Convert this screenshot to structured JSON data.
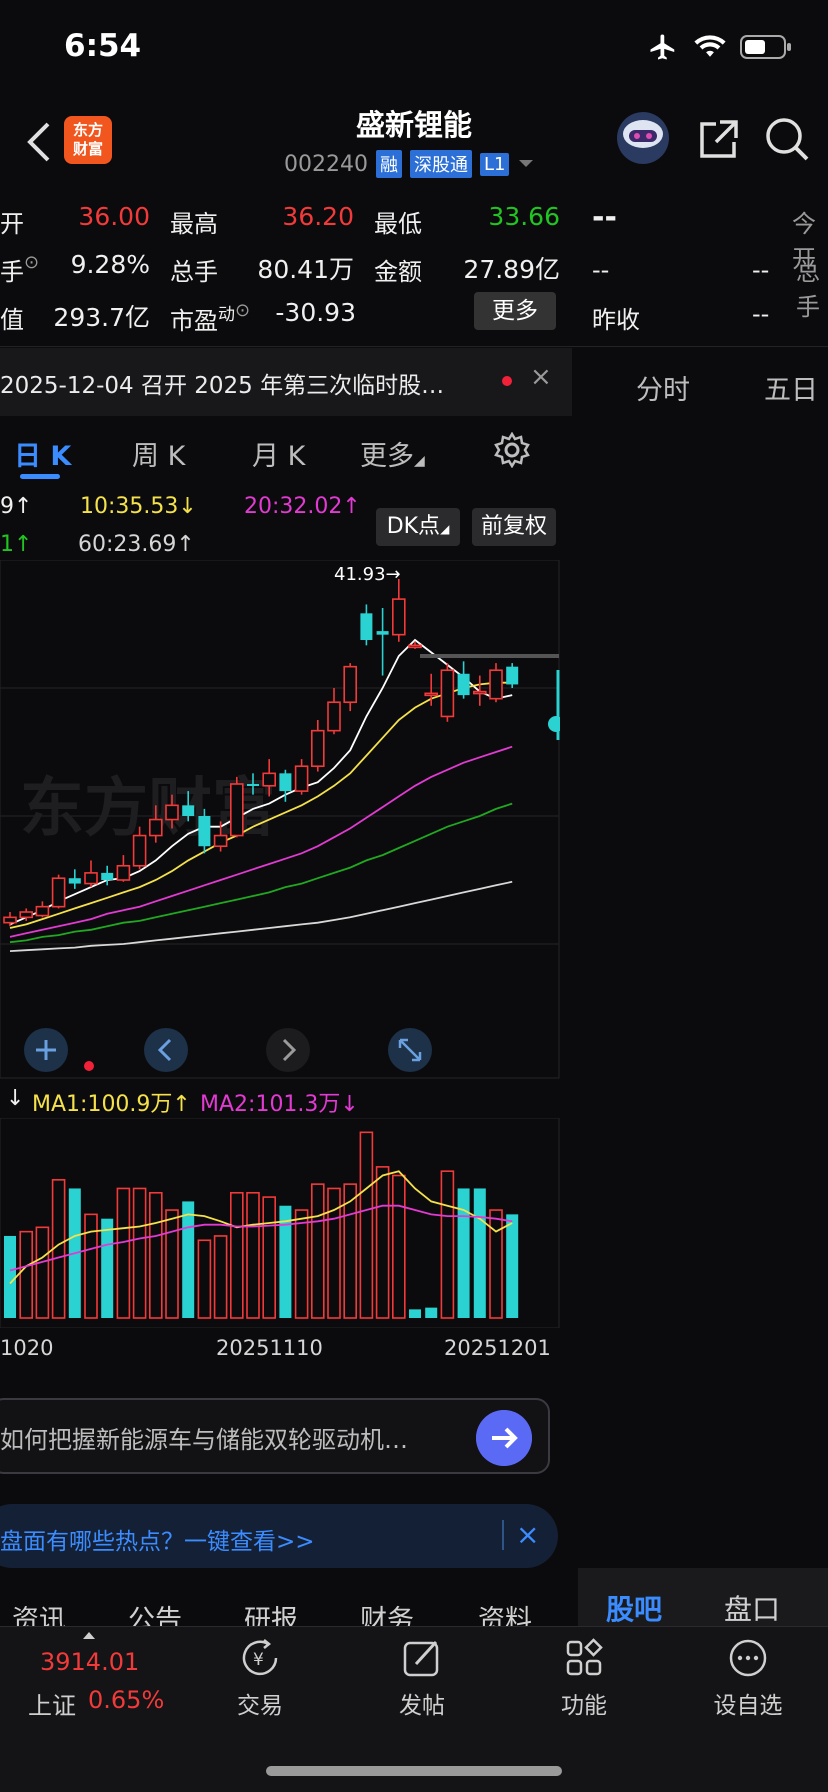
{
  "status": {
    "time": "6:54"
  },
  "header": {
    "logo_text_1": "东方",
    "logo_text_2": "财富",
    "stock_name": "盛新锂能",
    "stock_code": "002240",
    "tags": [
      "融",
      "深股通",
      "L1"
    ]
  },
  "quote": {
    "open_label": "开",
    "open_value": "36.00",
    "high_label": "最高",
    "high_value": "36.20",
    "low_label": "最低",
    "low_value": "33.66",
    "turnover_label": "手",
    "turnover_value": "9.28%",
    "volume_label": "总手",
    "volume_value": "80.41万",
    "amount_label": "金额",
    "amount_value": "27.89亿",
    "mktcap_label": "值",
    "mktcap_value": "293.7亿",
    "pe_label": "市盈",
    "pe_sup": "动",
    "pe_value": "-30.93",
    "more_label": "更多"
  },
  "right_quote": {
    "price": "--",
    "today_open_label": "今开",
    "r2_a": "--",
    "r2_b": "--",
    "total_label": "总手",
    "prev_close_label": "昨收",
    "prev_close_value": "--"
  },
  "notice": {
    "text": "2025-12-04 召开 2025 年第三次临时股…",
    "close": "×"
  },
  "period_tabs": [
    "日 K",
    "周 K",
    "月 K",
    "更多"
  ],
  "right_tabs": [
    "分时",
    "五日"
  ],
  "ma_legend": {
    "ma_a": "9↑",
    "ma10": "10:35.53↓",
    "ma20": "20:32.02↑",
    "ma_b": "1↑",
    "ma60": "60:23.69↑"
  },
  "buttons": {
    "dk": "DK点",
    "adjust": "前复权"
  },
  "chart": {
    "watermark": "东方财富",
    "high_marker": "41.93→",
    "colors": {
      "up": "#f23a3a",
      "down": "#2ad2d2"
    }
  },
  "volume": {
    "ma_prefix": "↓",
    "ma1": "MA1:100.9万↑",
    "ma2": "MA2:101.3万↓",
    "dates": [
      "1020",
      "20251110",
      "20251201"
    ]
  },
  "chart_data": {
    "type": "bar",
    "title": "",
    "candles": [
      {
        "o": 22.6,
        "c": 22.9,
        "h": 23.2,
        "l": 22.4
      },
      {
        "o": 22.9,
        "c": 23.2,
        "h": 23.4,
        "l": 22.7
      },
      {
        "o": 23.0,
        "c": 23.5,
        "h": 23.8,
        "l": 22.9
      },
      {
        "o": 23.5,
        "c": 25.1,
        "h": 25.3,
        "l": 23.4
      },
      {
        "o": 25.1,
        "c": 24.8,
        "h": 25.6,
        "l": 24.5
      },
      {
        "o": 24.8,
        "c": 25.4,
        "h": 26.1,
        "l": 24.6
      },
      {
        "o": 25.4,
        "c": 25.0,
        "h": 25.8,
        "l": 24.7
      },
      {
        "o": 25.0,
        "c": 25.8,
        "h": 26.4,
        "l": 24.9
      },
      {
        "o": 25.8,
        "c": 27.5,
        "h": 28.0,
        "l": 25.6
      },
      {
        "o": 27.5,
        "c": 28.4,
        "h": 29.2,
        "l": 27.1
      },
      {
        "o": 28.4,
        "c": 29.2,
        "h": 29.8,
        "l": 27.9
      },
      {
        "o": 29.2,
        "c": 28.6,
        "h": 30.0,
        "l": 28.3
      },
      {
        "o": 28.6,
        "c": 26.9,
        "h": 29.0,
        "l": 26.5
      },
      {
        "o": 26.9,
        "c": 27.5,
        "h": 28.3,
        "l": 26.6
      },
      {
        "o": 27.5,
        "c": 30.4,
        "h": 30.8,
        "l": 27.4
      },
      {
        "o": 30.4,
        "c": 30.3,
        "h": 31.0,
        "l": 29.8
      },
      {
        "o": 30.3,
        "c": 31.0,
        "h": 31.8,
        "l": 29.7
      },
      {
        "o": 31.0,
        "c": 30.0,
        "h": 31.2,
        "l": 29.4
      },
      {
        "o": 30.0,
        "c": 31.4,
        "h": 31.8,
        "l": 29.8
      },
      {
        "o": 31.4,
        "c": 33.4,
        "h": 34.0,
        "l": 31.1
      },
      {
        "o": 33.4,
        "c": 35.0,
        "h": 35.8,
        "l": 33.2
      },
      {
        "o": 35.0,
        "c": 37.0,
        "h": 37.2,
        "l": 34.5
      },
      {
        "o": 40.0,
        "c": 38.5,
        "h": 40.5,
        "l": 38.2
      },
      {
        "o": 39.0,
        "c": 38.8,
        "h": 40.3,
        "l": 36.5
      },
      {
        "o": 38.8,
        "c": 40.8,
        "h": 41.93,
        "l": 38.4
      },
      {
        "o": 38.2,
        "c": 38.2,
        "h": 38.4,
        "l": 38.0
      },
      {
        "o": 35.5,
        "c": 35.5,
        "h": 36.6,
        "l": 34.8
      },
      {
        "o": 34.2,
        "c": 36.8,
        "h": 37.2,
        "l": 33.9
      },
      {
        "o": 36.6,
        "c": 35.4,
        "h": 37.3,
        "l": 35.2
      },
      {
        "o": 35.6,
        "c": 35.6,
        "h": 36.5,
        "l": 34.8
      },
      {
        "o": 35.2,
        "c": 36.8,
        "h": 37.2,
        "l": 35.0
      },
      {
        "o": 37.0,
        "c": 36.0,
        "h": 37.2,
        "l": 35.8
      }
    ],
    "volumes": [
      {
        "v": 95,
        "up": false
      },
      {
        "v": 100,
        "up": true
      },
      {
        "v": 105,
        "up": true
      },
      {
        "v": 160,
        "up": true
      },
      {
        "v": 150,
        "up": false
      },
      {
        "v": 120,
        "up": true
      },
      {
        "v": 115,
        "up": false
      },
      {
        "v": 150,
        "up": true
      },
      {
        "v": 150,
        "up": true
      },
      {
        "v": 145,
        "up": true
      },
      {
        "v": 125,
        "up": true
      },
      {
        "v": 135,
        "up": false
      },
      {
        "v": 90,
        "up": true
      },
      {
        "v": 95,
        "up": true
      },
      {
        "v": 145,
        "up": true
      },
      {
        "v": 145,
        "up": true
      },
      {
        "v": 140,
        "up": true
      },
      {
        "v": 130,
        "up": false
      },
      {
        "v": 125,
        "up": true
      },
      {
        "v": 155,
        "up": true
      },
      {
        "v": 150,
        "up": true
      },
      {
        "v": 155,
        "up": true
      },
      {
        "v": 215,
        "up": true
      },
      {
        "v": 175,
        "up": true
      },
      {
        "v": 165,
        "up": true
      },
      {
        "v": 10,
        "up": false
      },
      {
        "v": 12,
        "up": false
      },
      {
        "v": 170,
        "up": true
      },
      {
        "v": 150,
        "up": false
      },
      {
        "v": 150,
        "up": false
      },
      {
        "v": 125,
        "up": true
      },
      {
        "v": 120,
        "up": false
      }
    ],
    "ma5": [
      22.5,
      22.9,
      23.3,
      23.8,
      24.2,
      24.6,
      25.0,
      25.1,
      25.5,
      26.1,
      26.9,
      27.6,
      28.0,
      28.0,
      28.5,
      29.0,
      29.3,
      29.8,
      30.2,
      30.5,
      31.3,
      32.3,
      34.2,
      35.8,
      37.6,
      38.5,
      37.8,
      37.1,
      36.4,
      35.6,
      35.2,
      35.4
    ],
    "ma10": [
      22.3,
      22.5,
      22.8,
      23.1,
      23.4,
      23.7,
      24.0,
      24.3,
      24.6,
      25.0,
      25.5,
      26.1,
      26.6,
      27.1,
      27.5,
      28.0,
      28.4,
      28.8,
      29.2,
      29.7,
      30.3,
      31.0,
      32.0,
      33.0,
      34.0,
      34.7,
      35.2,
      35.5,
      35.8,
      36.0,
      36.1,
      36.1
    ],
    "ma20": [
      21.8,
      22.0,
      22.2,
      22.4,
      22.6,
      22.8,
      23.1,
      23.3,
      23.5,
      23.8,
      24.1,
      24.4,
      24.7,
      25.0,
      25.3,
      25.6,
      25.9,
      26.2,
      26.5,
      26.9,
      27.4,
      27.9,
      28.5,
      29.1,
      29.7,
      30.3,
      30.8,
      31.2,
      31.6,
      31.9,
      32.2,
      32.5
    ],
    "ma30": [
      21.5,
      21.6,
      21.8,
      21.9,
      22.1,
      22.2,
      22.4,
      22.6,
      22.7,
      22.9,
      23.1,
      23.3,
      23.5,
      23.7,
      23.9,
      24.1,
      24.3,
      24.6,
      24.8,
      25.1,
      25.4,
      25.7,
      26.1,
      26.4,
      26.8,
      27.2,
      27.6,
      28.0,
      28.3,
      28.6,
      29.0,
      29.3
    ],
    "ma60": [
      21.0,
      21.05,
      21.1,
      21.15,
      21.2,
      21.3,
      21.35,
      21.4,
      21.5,
      21.6,
      21.7,
      21.8,
      21.9,
      22.0,
      22.1,
      22.2,
      22.3,
      22.4,
      22.5,
      22.6,
      22.75,
      22.9,
      23.1,
      23.3,
      23.5,
      23.7,
      23.9,
      24.1,
      24.3,
      24.5,
      24.7,
      24.9
    ],
    "vol_ma1": [
      40,
      60,
      70,
      85,
      95,
      100,
      102,
      104,
      106,
      110,
      115,
      120,
      118,
      112,
      105,
      108,
      110,
      112,
      115,
      118,
      125,
      135,
      150,
      165,
      170,
      150,
      135,
      130,
      125,
      115,
      100,
      110
    ],
    "vol_ma2": [
      55,
      60,
      65,
      70,
      75,
      80,
      85,
      88,
      92,
      95,
      100,
      105,
      108,
      108,
      106,
      106,
      107,
      108,
      110,
      112,
      115,
      120,
      125,
      130,
      130,
      125,
      120,
      118,
      118,
      117,
      115,
      112
    ]
  },
  "ask": {
    "text": "如何把握新能源车与储能双轮驱动机…"
  },
  "hot": {
    "text": "盘面有哪些热点？一键查看>>",
    "close": "×"
  },
  "news_tabs": [
    "资讯",
    "公告",
    "研报",
    "财务",
    "资料"
  ],
  "right_bottom_tabs": [
    "股吧",
    "盘口"
  ],
  "bottom_nav": {
    "index_value": "3914.01",
    "index_name": "上证",
    "index_change": "0.65%",
    "items": [
      "交易",
      "发帖",
      "功能",
      "设自选"
    ]
  }
}
